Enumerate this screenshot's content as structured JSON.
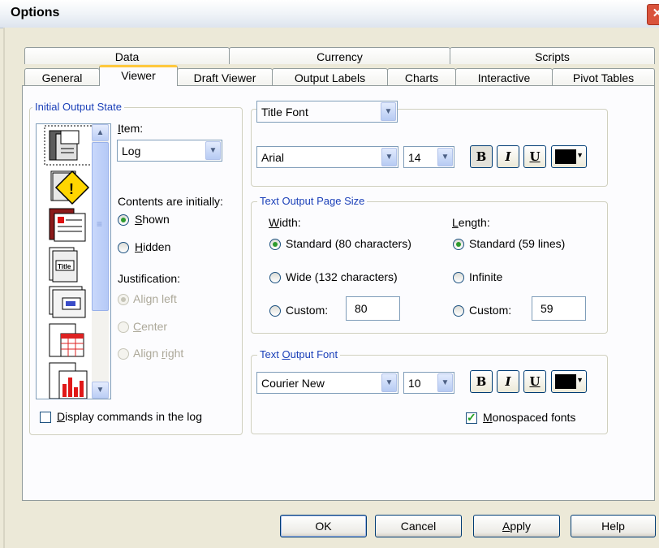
{
  "window": {
    "title": "Options",
    "close_glyph": "✕"
  },
  "tabs_back": [
    "Data",
    "Currency",
    "Scripts"
  ],
  "tabs_front": [
    "General",
    "Viewer",
    "Draft Viewer",
    "Output Labels",
    "Charts",
    "Interactive",
    "Pivot Tables"
  ],
  "initial_output": {
    "group_label": "Initial Output State",
    "item_label": "Item:",
    "item_value": "Log",
    "icons": [
      "log-icon",
      "warning-icon",
      "notes-icon",
      "title-icon",
      "page-title-icon",
      "pivot-table-icon",
      "chart-icon"
    ],
    "contents_label": "Contents are initially:",
    "shown": "Shown",
    "hidden": "Hidden",
    "justification_label": "Justification:",
    "align_left": "Align left",
    "center": "Center",
    "align_right": "Align right",
    "display_commands": "Display commands in the log"
  },
  "title_font": {
    "selector": "Title Font",
    "font": "Arial",
    "size": "14"
  },
  "page_size": {
    "group_label": "Text Output Page Size",
    "width_label": "Width:",
    "width_standard": "Standard (80 characters)",
    "width_wide": "Wide (132 characters)",
    "width_custom": "Custom:",
    "width_custom_value": "80",
    "length_label": "Length:",
    "length_standard": "Standard (59 lines)",
    "length_infinite": "Infinite",
    "length_custom": "Custom:",
    "length_custom_value": "59"
  },
  "output_font": {
    "group_label": "Text Output Font",
    "font": "Courier New",
    "size": "10",
    "monospaced": "Monospaced fonts"
  },
  "style_buttons": {
    "bold": "B",
    "italic": "I",
    "underline": "U"
  },
  "colors": {
    "text_color": "#000000",
    "active_tab_accent": "#ffc83c",
    "group_label": "#1a3fb8"
  },
  "buttons": {
    "ok": "OK",
    "cancel": "Cancel",
    "apply": "Apply",
    "help": "Help"
  }
}
